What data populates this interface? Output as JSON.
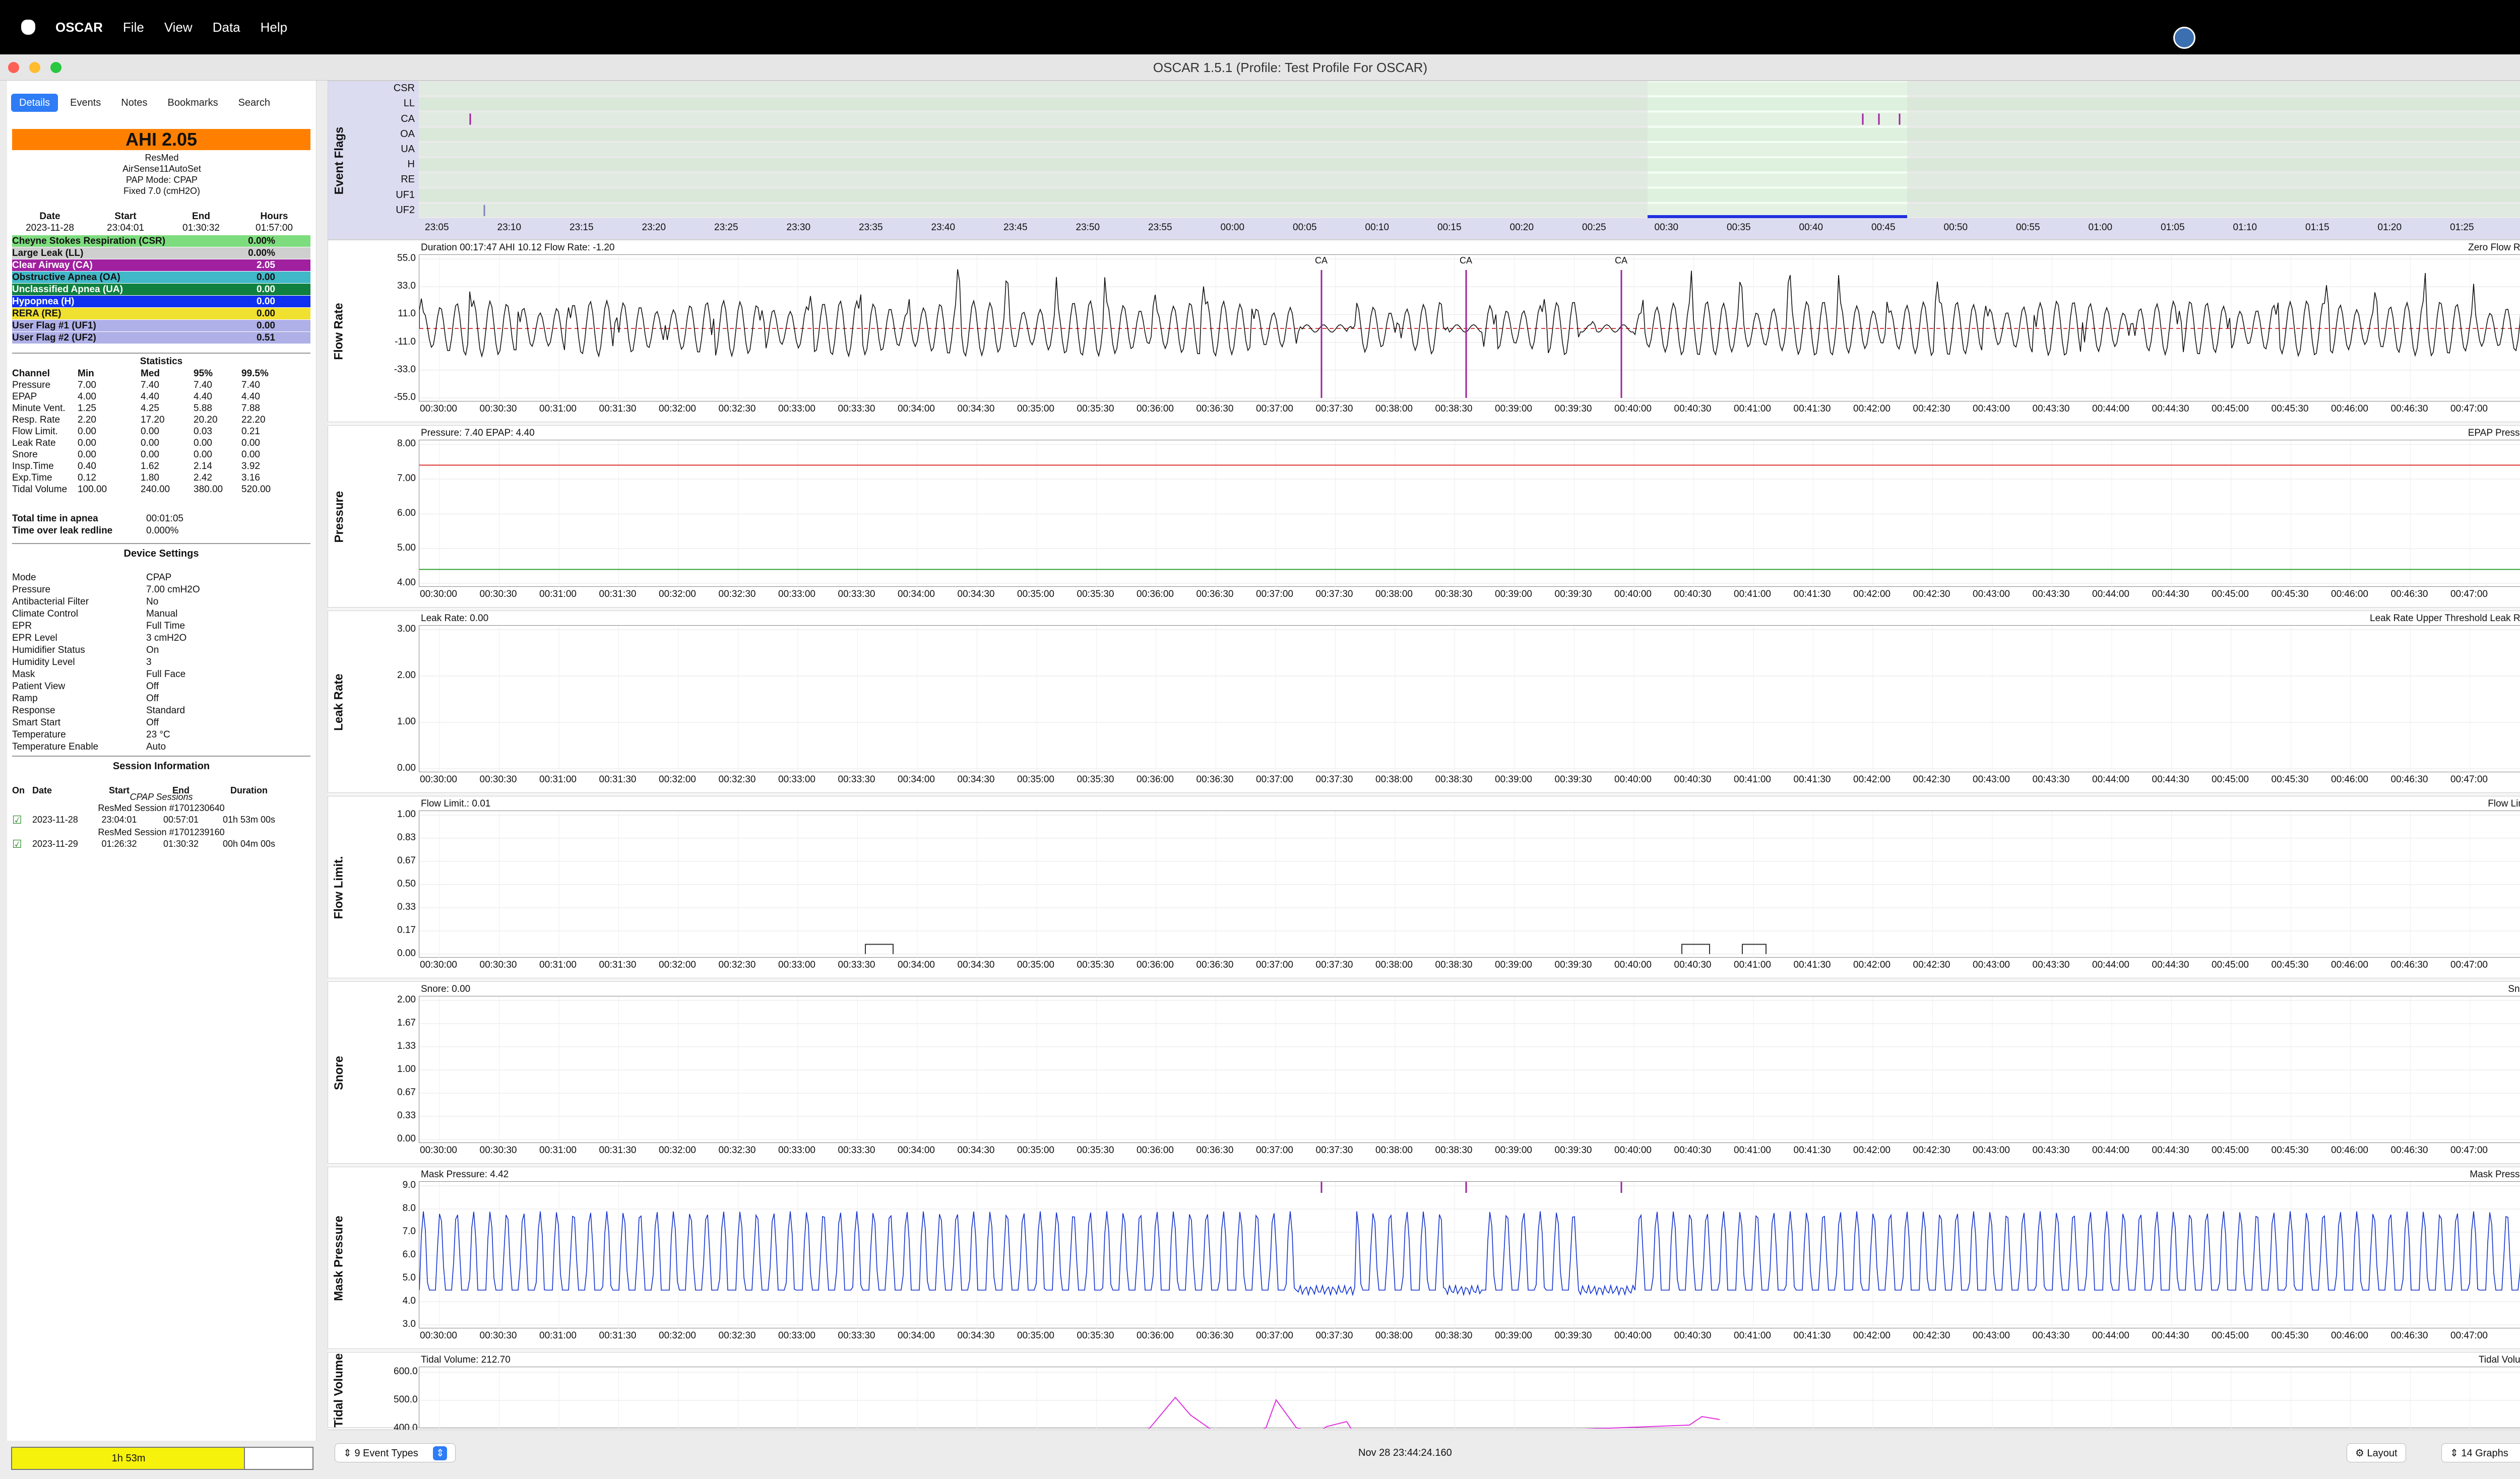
{
  "menubar": {
    "app": "OSCAR",
    "items": [
      "File",
      "View",
      "Data",
      "Help"
    ]
  },
  "window": {
    "title": "OSCAR 1.5.1 (Profile: Test Profile For OSCAR)"
  },
  "tabs": [
    "Details",
    "Events",
    "Notes",
    "Bookmarks",
    "Search"
  ],
  "summary": {
    "ahi": "AHI 2.05",
    "manufacturer": "ResMed",
    "model": "AirSense11AutoSet",
    "mode": "PAP Mode: CPAP",
    "fixed": "Fixed 7.0 (cmH2O)"
  },
  "session_header": {
    "date_label": "Date",
    "start_label": "Start",
    "end_label": "End",
    "hours_label": "Hours",
    "date": "2023-11-28",
    "start": "23:04:01",
    "end": "01:30:32",
    "hours": "01:57:00"
  },
  "events": [
    {
      "name": "Cheyne Stokes Respiration (CSR)",
      "value": "0.00%",
      "color": "#7ddc7d"
    },
    {
      "name": "Large Leak (LL)",
      "value": "0.00%",
      "color": "#cfcfcf"
    },
    {
      "name": "Clear Airway (CA)",
      "value": "2.05",
      "color": "#a020a0",
      "text": "#fff"
    },
    {
      "name": "Obstructive Apnea (OA)",
      "value": "0.00",
      "color": "#40b8c8"
    },
    {
      "name": "Unclassified Apnea (UA)",
      "value": "0.00",
      "color": "#108040",
      "text": "#fff"
    },
    {
      "name": "Hypopnea (H)",
      "value": "0.00",
      "color": "#1030f0",
      "text": "#fff"
    },
    {
      "name": "RERA (RE)",
      "value": "0.00",
      "color": "#f0e030"
    },
    {
      "name": "User Flag #1 (UF1)",
      "value": "0.00",
      "color": "#b0b0e8"
    },
    {
      "name": "User Flag #2 (UF2)",
      "value": "0.51",
      "color": "#b0b0e8"
    }
  ],
  "statistics": {
    "title": "Statistics",
    "headers": [
      "Channel",
      "Min",
      "Med",
      "95%",
      "99.5%"
    ],
    "rows": [
      [
        "Pressure",
        "7.00",
        "7.40",
        "7.40",
        "7.40"
      ],
      [
        "EPAP",
        "4.00",
        "4.40",
        "4.40",
        "4.40"
      ],
      [
        "Minute Vent.",
        "1.25",
        "4.25",
        "5.88",
        "7.88"
      ],
      [
        "Resp. Rate",
        "2.20",
        "17.20",
        "20.20",
        "22.20"
      ],
      [
        "Flow Limit.",
        "0.00",
        "0.00",
        "0.03",
        "0.21"
      ],
      [
        "Leak Rate",
        "0.00",
        "0.00",
        "0.00",
        "0.00"
      ],
      [
        "Snore",
        "0.00",
        "0.00",
        "0.00",
        "0.00"
      ],
      [
        "Insp.Time",
        "0.40",
        "1.62",
        "2.14",
        "3.92"
      ],
      [
        "Exp.Time",
        "0.12",
        "1.80",
        "2.42",
        "3.16"
      ],
      [
        "Tidal Volume",
        "100.00",
        "240.00",
        "380.00",
        "520.00"
      ]
    ]
  },
  "apnea_time": {
    "label": "Total time in apnea",
    "value": "00:01:05"
  },
  "leak_redline": {
    "label": "Time over leak redline",
    "value": "0.000%"
  },
  "device_settings": {
    "title": "Device Settings",
    "rows": [
      [
        "Mode",
        "CPAP"
      ],
      [
        "Pressure",
        "7.00 cmH2O"
      ],
      [
        "Antibacterial Filter",
        "No"
      ],
      [
        "Climate Control",
        "Manual"
      ],
      [
        "EPR",
        "Full Time"
      ],
      [
        "EPR Level",
        "3 cmH2O"
      ],
      [
        "Humidifier Status",
        "On"
      ],
      [
        "Humidity Level",
        "3"
      ],
      [
        "Mask",
        "Full Face"
      ],
      [
        "Patient View",
        "Off"
      ],
      [
        "Ramp",
        "Off"
      ],
      [
        "Response",
        "Standard"
      ],
      [
        "Smart Start",
        "Off"
      ],
      [
        "Temperature",
        "23 °C"
      ],
      [
        "Temperature Enable",
        "Auto"
      ]
    ]
  },
  "session_info": {
    "title": "Session Information",
    "headers": [
      "On",
      "Date",
      "Start",
      "End",
      "Duration"
    ],
    "cpap_label": "CPAP Sessions",
    "sessions": [
      {
        "name": "ResMed Session #1701230640",
        "date": "2023-11-28",
        "start": "23:04:01",
        "end": "00:57:01",
        "duration": "01h 53m 00s"
      },
      {
        "name": "ResMed Session #1701239160",
        "date": "2023-11-29",
        "start": "01:26:32",
        "end": "01:30:32",
        "duration": "00h 04m 00s"
      }
    ]
  },
  "progress": {
    "label": "1h 53m",
    "fraction": 0.77
  },
  "event_flags": {
    "label": "Event Flags",
    "rows": [
      "CSR",
      "LL",
      "CA",
      "OA",
      "UA",
      "H",
      "RE",
      "UF1",
      "UF2"
    ],
    "time_ticks": [
      "23:05",
      "23:10",
      "23:15",
      "23:20",
      "23:25",
      "23:30",
      "23:35",
      "23:40",
      "23:45",
      "23:50",
      "23:55",
      "00:00",
      "00:05",
      "00:10",
      "00:15",
      "00:20",
      "00:25",
      "00:30",
      "00:35",
      "00:40",
      "00:45",
      "00:50",
      "00:55",
      "01:00",
      "01:05",
      "01:10",
      "01:15",
      "01:20",
      "01:25"
    ]
  },
  "xticks": [
    "00:30:00",
    "00:30:30",
    "00:31:00",
    "00:31:30",
    "00:32:00",
    "00:32:30",
    "00:33:00",
    "00:33:30",
    "00:34:00",
    "00:34:30",
    "00:35:00",
    "00:35:30",
    "00:36:00",
    "00:36:30",
    "00:37:00",
    "00:37:30",
    "00:38:00",
    "00:38:30",
    "00:39:00",
    "00:39:30",
    "00:40:00",
    "00:40:30",
    "00:41:00",
    "00:41:30",
    "00:42:00",
    "00:42:30",
    "00:43:00",
    "00:43:30",
    "00:44:00",
    "00:44:30",
    "00:45:00",
    "00:45:30",
    "00:46:00",
    "00:46:30",
    "00:47:00"
  ],
  "graphs": [
    {
      "label": "Flow Rate",
      "title": "Duration 00:17:47 AHI 10.12 Flow Rate: -1.20",
      "legend": "Zero  Flow Rate",
      "yticks": [
        "55.0",
        "33.0",
        "11.0",
        "-11.0",
        "-33.0",
        "-55.0"
      ],
      "ymin": -55,
      "ymax": 55,
      "ca_label": "CA"
    },
    {
      "label": "Pressure",
      "title": "Pressure: 7.40 EPAP: 4.40",
      "legend": "EPAP  Pressure",
      "yticks": [
        "8.00",
        "7.00",
        "6.00",
        "5.00",
        "4.00"
      ],
      "ymin": 4,
      "ymax": 8,
      "pressure": 7.4,
      "epap": 4.4
    },
    {
      "label": "Leak Rate",
      "title": "Leak Rate: 0.00",
      "legend": "Leak Rate Upper Threshold  Leak Rate",
      "yticks": [
        "3.00",
        "2.00",
        "1.00",
        "0.00"
      ],
      "ymin": 0,
      "ymax": 3
    },
    {
      "label": "Flow Limit.",
      "title": "Flow Limit.: 0.01",
      "legend": "Flow Limit.",
      "yticks": [
        "1.00",
        "0.83",
        "0.67",
        "0.50",
        "0.33",
        "0.17",
        "0.00"
      ],
      "ymin": 0,
      "ymax": 1
    },
    {
      "label": "Snore",
      "title": "Snore: 0.00",
      "legend": "Snore",
      "yticks": [
        "2.00",
        "1.67",
        "1.33",
        "1.00",
        "0.67",
        "0.33",
        "0.00"
      ],
      "ymin": 0,
      "ymax": 2
    },
    {
      "label": "Mask Pressure",
      "title": "Mask Pressure: 4.42",
      "legend": "Mask Pressure",
      "yticks": [
        "9.0",
        "8.0",
        "7.0",
        "6.0",
        "5.0",
        "4.0",
        "3.0"
      ],
      "ymin": 3,
      "ymax": 9
    },
    {
      "label": "Tidal Volume",
      "title": "Tidal Volume: 212.70",
      "legend": "Tidal Volume",
      "yticks": [
        "600.0",
        "500.0",
        "400.0"
      ],
      "ymin": 380,
      "ymax": 620
    }
  ],
  "bottombar": {
    "event_types": "9 Event Types",
    "timestamp": "Nov 28 23:44:24.160",
    "layout": "Layout",
    "graphs": "14 Graphs"
  }
}
